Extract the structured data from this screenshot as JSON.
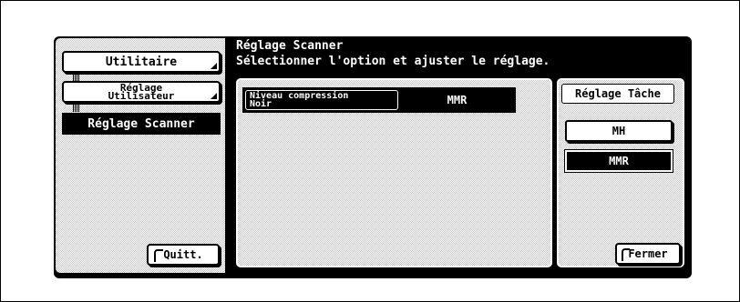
{
  "sidebar": {
    "utilitaire_label": "Utilitaire",
    "reglage_utilisateur_line1": "Réglage",
    "reglage_utilisateur_line2": "Utilisateur",
    "reglage_scanner_label": "Réglage Scanner",
    "quit_label": "Quitt."
  },
  "header": {
    "title": "Réglage Scanner",
    "subtitle": "Sélectionner l'option et ajuster le réglage."
  },
  "setting": {
    "label_line1": "Niveau compression",
    "label_line2": "Noir",
    "value": "MMR"
  },
  "task_panel": {
    "title": "Réglage Tâche",
    "options": [
      "MH",
      "MMR"
    ],
    "selected": "MMR"
  },
  "footer": {
    "close_label": "Fermer"
  }
}
